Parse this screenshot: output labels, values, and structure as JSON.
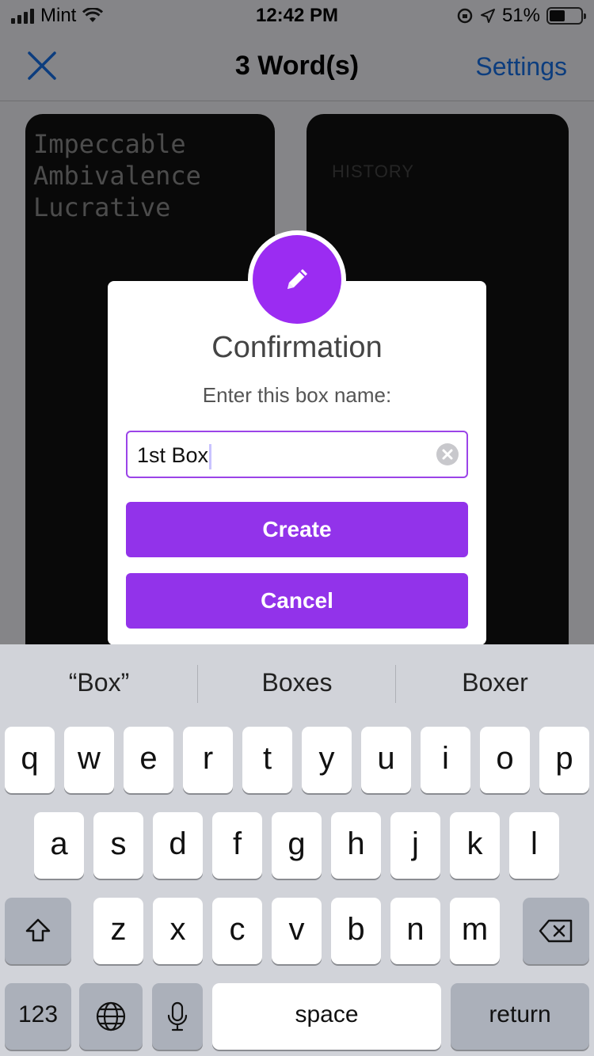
{
  "status_bar": {
    "carrier": "Mint",
    "time": "12:42 PM",
    "battery_percent": "51%",
    "battery_level": 0.51
  },
  "nav": {
    "title": "3 Word(s)",
    "settings_label": "Settings"
  },
  "word_card": {
    "words": [
      "Impeccable",
      "Ambivalence",
      "Lucrative"
    ]
  },
  "history_card": {
    "label": "HISTORY"
  },
  "dialog": {
    "title": "Confirmation",
    "message": "Enter this box name:",
    "input_value": "1st Box",
    "create_label": "Create",
    "cancel_label": "Cancel",
    "accent_color": "#9233ea"
  },
  "keyboard": {
    "predictions": [
      "“Box”",
      "Boxes",
      "Boxer"
    ],
    "row1": [
      "q",
      "w",
      "e",
      "r",
      "t",
      "y",
      "u",
      "i",
      "o",
      "p"
    ],
    "row2": [
      "a",
      "s",
      "d",
      "f",
      "g",
      "h",
      "j",
      "k",
      "l"
    ],
    "row3": [
      "z",
      "x",
      "c",
      "v",
      "b",
      "n",
      "m"
    ],
    "numbers_label": "123",
    "space_label": "space",
    "return_label": "return"
  }
}
